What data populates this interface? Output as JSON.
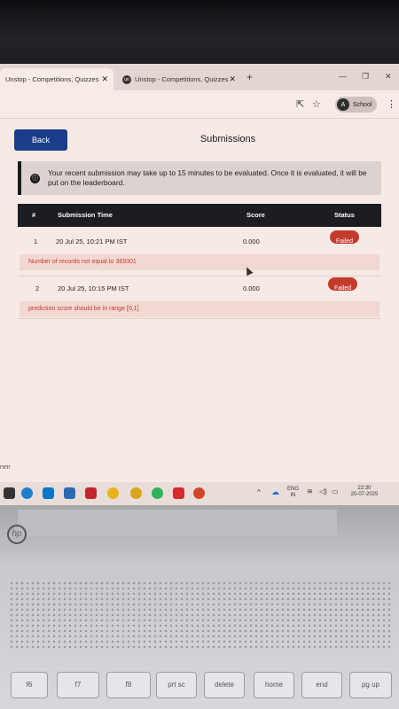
{
  "browser": {
    "tabs": [
      {
        "label": "Unstop - Competitions, Quizzes",
        "active": true
      },
      {
        "label": "Unstop - Competitions, Quizzes",
        "active": false,
        "favicon": "un"
      }
    ],
    "new_tab_symbol": "+",
    "close_symbol": "✕",
    "window_controls": {
      "minimize": "—",
      "restore": "❐",
      "close": "✕"
    },
    "profile": {
      "initial": "A",
      "label": "School"
    },
    "icons": [
      "share-icon",
      "star-icon"
    ]
  },
  "page": {
    "back_label": "Back",
    "title": "Submissions",
    "notice": "Your recent submission may take up to 15 minutes to be evaluated. Once it is evaluated, it will be put on the leaderboard.",
    "notice_icon": "ⓘ",
    "table": {
      "headers": [
        "#",
        "Submission Time",
        "Score",
        "Status"
      ],
      "rows": [
        {
          "num": "1",
          "time": "20 Jul 25, 10:21 PM IST",
          "score": "0.000",
          "status": "Failed",
          "error": "Number of records not equal to 369301"
        },
        {
          "num": "2",
          "time": "20 Jul 25, 10:15 PM IST",
          "score": "0.000",
          "status": "Failed",
          "error": "prediction score should be in range [0,1]"
        }
      ]
    },
    "left_stub": "neir"
  },
  "taskbar": {
    "lang_top": "ENG",
    "lang_bottom": "IN",
    "time": "22:30",
    "date": "20-07-2025",
    "caret": "^"
  },
  "laptop": {
    "logo": "hp",
    "keys": [
      "f6",
      "f7",
      "f8",
      "prt sc",
      "delete",
      "home",
      "end",
      "pg up"
    ]
  },
  "colors": {
    "back_button": "#1b3d8a",
    "header_bg": "#1c1d22",
    "failed_badge": "#c43b2c",
    "error_text": "#c33b30",
    "error_bg": "#f1d8d2"
  }
}
